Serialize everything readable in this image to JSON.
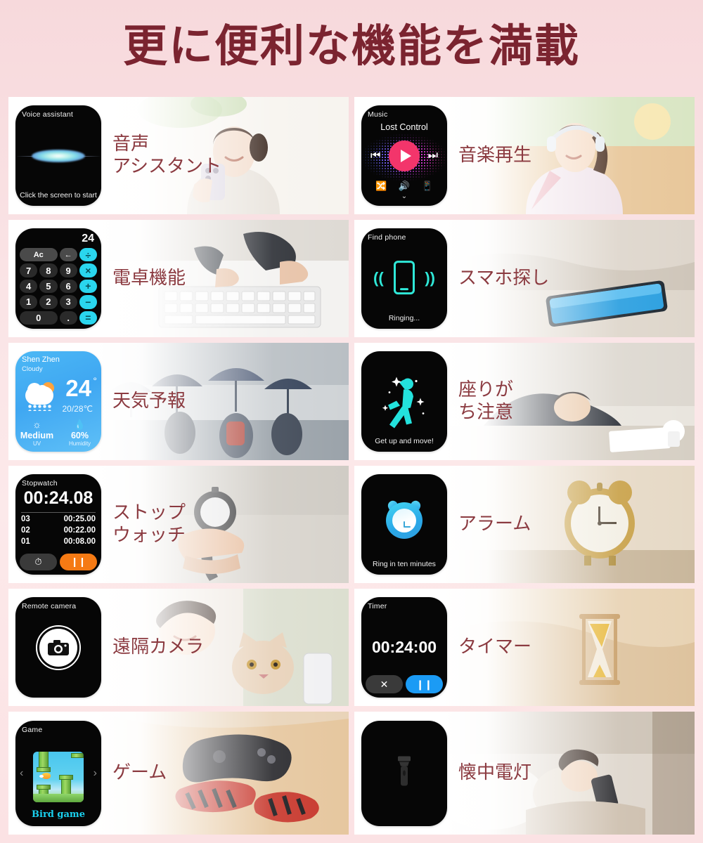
{
  "header": {
    "title": "更に便利な機能を満載"
  },
  "theme": {
    "title_color": "#7b2430",
    "label_color": "#8b3a40",
    "accent_cyan": "#2ad6ee",
    "accent_pink": "#f3356b",
    "accent_orange": "#f57a14",
    "accent_blue": "#1b9bf5",
    "background_pink": "#fae4e6",
    "card_background": "#ffffff",
    "screen_background": "#060606"
  },
  "cards": [
    {
      "id": "voice-assistant",
      "label": "音声\nアシスタント",
      "screen": {
        "title": "Voice assistant",
        "footer": "Click the screen to start"
      }
    },
    {
      "id": "music",
      "label": "音楽再生",
      "screen": {
        "title": "Music",
        "track": "Lost Control",
        "controls": [
          "shuffle-icon",
          "volume-icon",
          "phone-icon"
        ]
      }
    },
    {
      "id": "calculator",
      "label": "電卓機能",
      "screen": {
        "display": "24",
        "keys": [
          "Ac",
          "←",
          "÷",
          "7",
          "8",
          "9",
          "×",
          "4",
          "5",
          "6",
          "+",
          "1",
          "2",
          "3",
          "−",
          "0",
          ".",
          "="
        ]
      }
    },
    {
      "id": "find-phone",
      "label": "スマホ探し",
      "screen": {
        "title": "Find phone",
        "footer": "Ringing..."
      }
    },
    {
      "id": "weather",
      "label": "天気予報",
      "screen": {
        "city": "Shen Zhen",
        "condition": "Cloudy",
        "temp": "24",
        "degree": "°",
        "range": "20/28℃",
        "uv_value": "Medium",
        "uv_caption": "UV",
        "humidity_value": "60%",
        "humidity_caption": "Humidity"
      }
    },
    {
      "id": "sedentary-reminder",
      "label": "座りが\nち注意",
      "screen": {
        "footer": "Get up and move!"
      }
    },
    {
      "id": "stopwatch",
      "label": "ストップ\nウォッチ",
      "screen": {
        "title": "Stopwatch",
        "time": "00:24.08",
        "laps": [
          {
            "index": "03",
            "time": "00:25.00"
          },
          {
            "index": "02",
            "time": "00:22.00"
          },
          {
            "index": "01",
            "time": "00:08.00"
          }
        ],
        "reset_icon": "stopwatch-icon",
        "pause_icon": "pause-icon"
      }
    },
    {
      "id": "alarm",
      "label": "アラーム",
      "screen": {
        "footer": "Ring in ten minutes"
      }
    },
    {
      "id": "remote-camera",
      "label": "遠隔カメラ",
      "screen": {
        "title": "Remote camera"
      }
    },
    {
      "id": "timer",
      "label": "タイマー",
      "screen": {
        "title": "Timer",
        "time": "00:24:00",
        "cancel_icon": "close-icon",
        "pause_icon": "pause-icon"
      }
    },
    {
      "id": "game",
      "label": "ゲーム",
      "screen": {
        "title": "Game",
        "game_name": "Bird game",
        "prev": "‹",
        "next": "›"
      }
    },
    {
      "id": "flashlight",
      "label": "懐中電灯",
      "screen": {
        "icon": "flashlight-icon"
      }
    }
  ]
}
